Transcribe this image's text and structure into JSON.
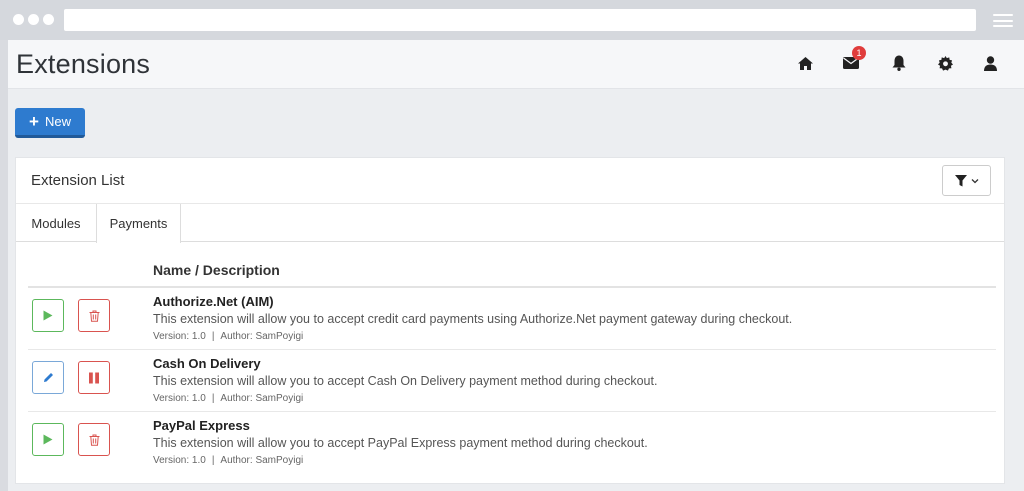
{
  "page": {
    "title": "Extensions",
    "notification_count": "1",
    "new_button_label": "New"
  },
  "header_icons": [
    "home-icon",
    "envelope-icon",
    "bell-icon",
    "gear-icon",
    "user-icon"
  ],
  "panel": {
    "title": "Extension List",
    "tabs": [
      {
        "label": "Modules",
        "active": false
      },
      {
        "label": "Payments",
        "active": true
      }
    ],
    "column_header": "Name / Description"
  },
  "extensions": [
    {
      "name": "Authorize.Net (AIM)",
      "description": "This extension will allow you to accept credit card payments using Authorize.Net payment gateway during checkout.",
      "version": "Version: 1.0",
      "author": "Author: SamPoyigi",
      "actions": [
        "play-icon",
        "trash-icon"
      ]
    },
    {
      "name": "Cash On Delivery",
      "description": "This extension will allow you to accept Cash On Delivery payment method during checkout.",
      "version": "Version: 1.0",
      "author": "Author: SamPoyigi",
      "actions": [
        "pencil-icon",
        "pause-icon"
      ]
    },
    {
      "name": "PayPal Express",
      "description": "This extension will allow you to accept PayPal Express payment method during checkout.",
      "version": "Version: 1.0",
      "author": "Author: SamPoyigi",
      "actions": [
        "play-icon",
        "trash-icon"
      ]
    }
  ],
  "meta_separator": "|",
  "colors": {
    "primary": "#2e7bcf",
    "success": "#5cb85c",
    "danger": "#d9534f",
    "badge": "#e03c3c"
  }
}
